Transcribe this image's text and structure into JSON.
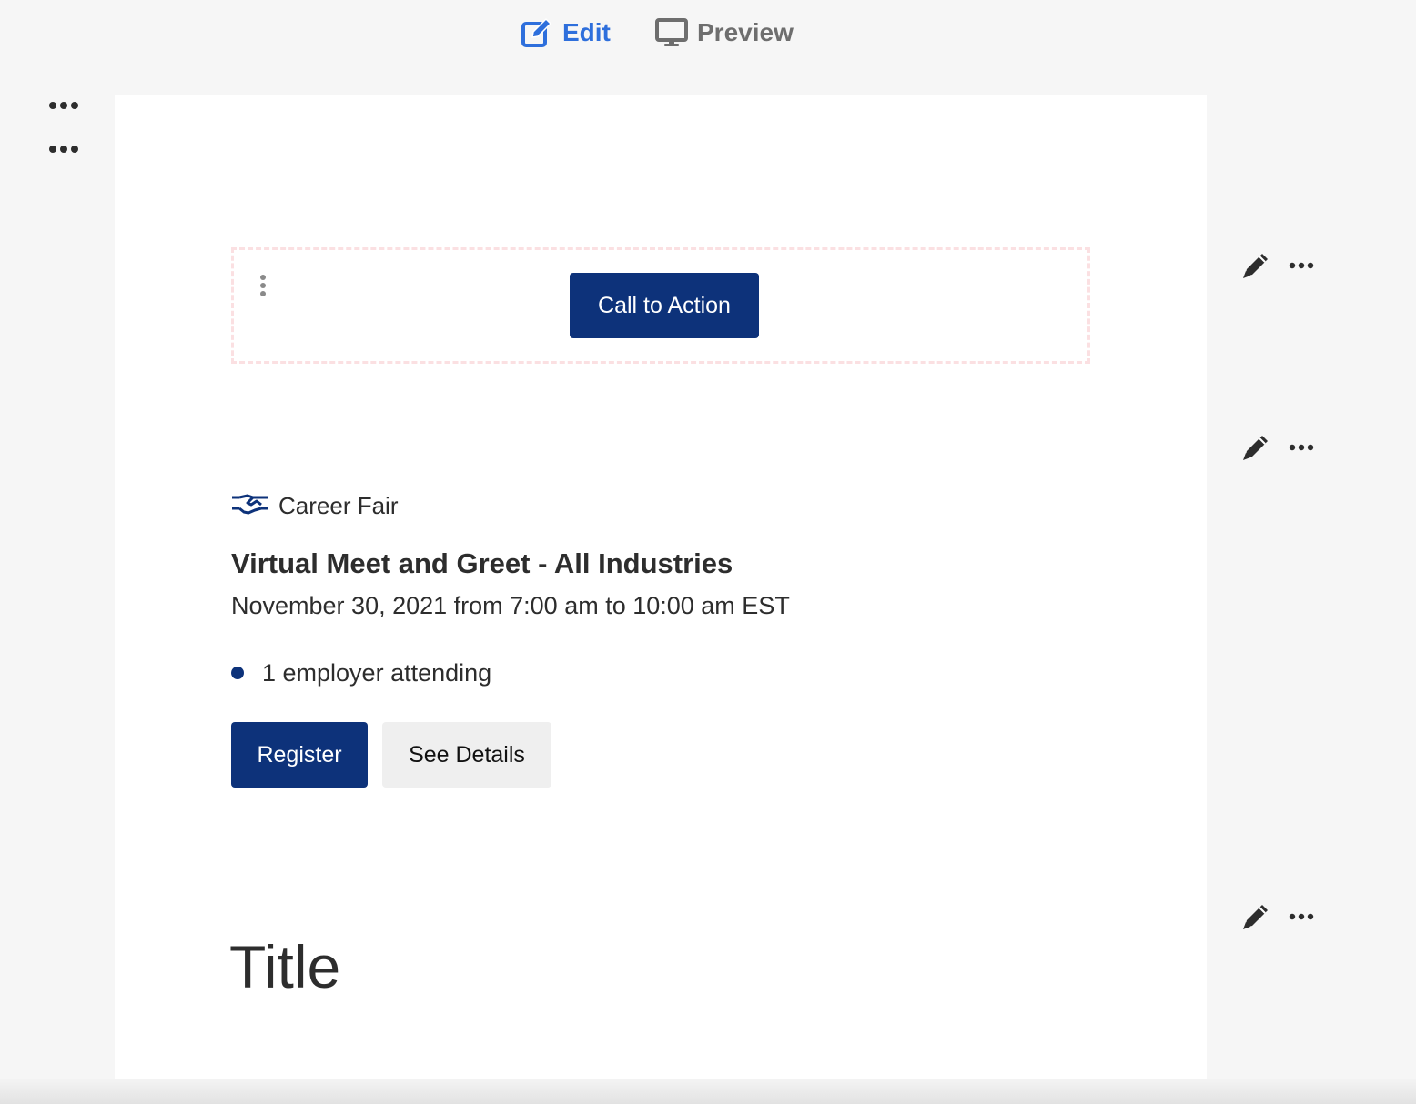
{
  "toolbar": {
    "edit_label": "Edit",
    "preview_label": "Preview",
    "edit_icon": "edit-icon",
    "preview_icon": "monitor-icon"
  },
  "cta": {
    "label": "Call to Action"
  },
  "event": {
    "type_icon": "handshake-icon",
    "type_label": "Career Fair",
    "title": "Virtual Meet and Greet - All Industries",
    "date": "November 30, 2021 from 7:00 am to 10:00 am EST",
    "attending": "1 employer attending",
    "register_label": "Register",
    "details_label": "See Details"
  },
  "title_block": {
    "text": "Title"
  },
  "colors": {
    "primary": "#0d327a",
    "edit_active": "#2e6fdc",
    "preview_inactive": "#6e6e6e",
    "cta_border": "#fbe0e2",
    "background": "#f6f6f6",
    "canvas": "#ffffff"
  }
}
